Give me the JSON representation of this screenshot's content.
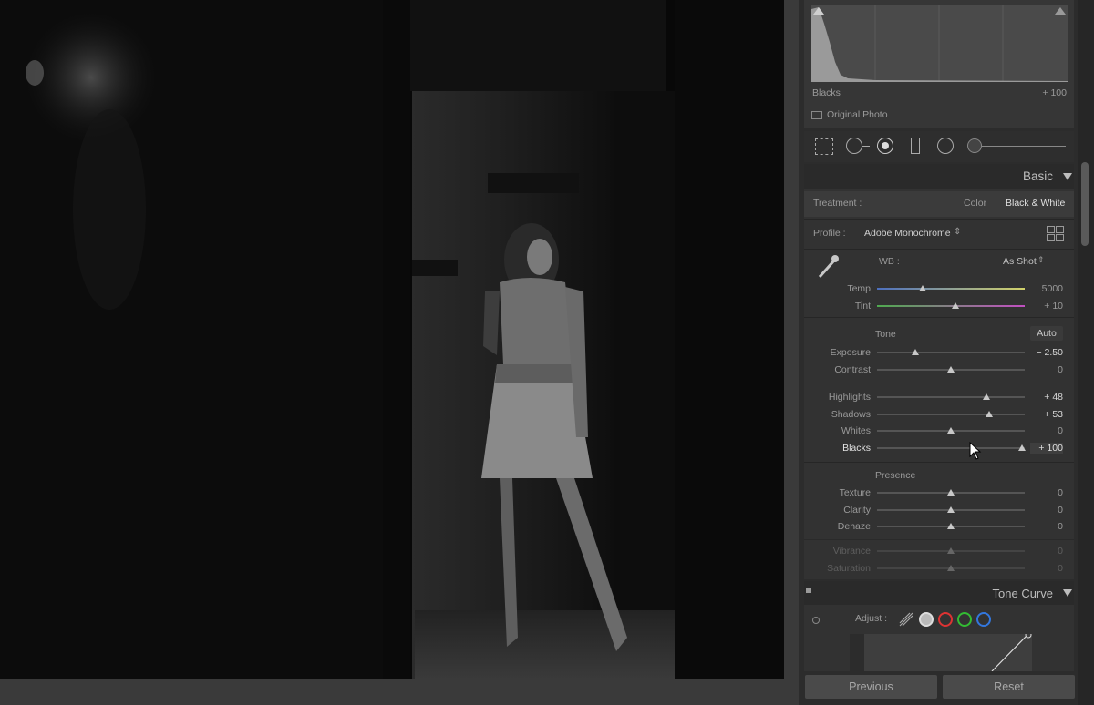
{
  "histogram": {
    "label": "Blacks",
    "value": "+ 100",
    "original_photo": "Original Photo"
  },
  "basic": {
    "title": "Basic",
    "treatment": {
      "label": "Treatment :",
      "color": "Color",
      "bw": "Black & White"
    },
    "profile": {
      "label": "Profile :",
      "value": "Adobe Monochrome"
    },
    "wb": {
      "label": "WB :",
      "value": "As Shot"
    },
    "temp": {
      "label": "Temp",
      "value": "5000",
      "pos": 0.31
    },
    "tint": {
      "label": "Tint",
      "value": "+ 10",
      "pos": 0.53
    },
    "tone_label": "Tone",
    "auto": "Auto",
    "tone": [
      {
        "key": "exposure",
        "label": "Exposure",
        "value": "− 2.50",
        "pos": 0.26
      },
      {
        "key": "contrast",
        "label": "Contrast",
        "value": "0",
        "pos": 0.5
      },
      {
        "key": "highlights",
        "label": "Highlights",
        "value": "+ 48",
        "pos": 0.74
      },
      {
        "key": "shadows",
        "label": "Shadows",
        "value": "+ 53",
        "pos": 0.76
      },
      {
        "key": "whites",
        "label": "Whites",
        "value": "0",
        "pos": 0.5
      },
      {
        "key": "blacks",
        "label": "Blacks",
        "value": "+ 100",
        "pos": 0.98
      }
    ],
    "presence_label": "Presence",
    "presence": [
      {
        "key": "texture",
        "label": "Texture",
        "value": "0",
        "pos": 0.5
      },
      {
        "key": "clarity",
        "label": "Clarity",
        "value": "0",
        "pos": 0.5
      },
      {
        "key": "dehaze",
        "label": "Dehaze",
        "value": "0",
        "pos": 0.5
      }
    ],
    "presence_dim": [
      {
        "key": "vibrance",
        "label": "Vibrance",
        "value": "0",
        "pos": 0.5
      },
      {
        "key": "saturation",
        "label": "Saturation",
        "value": "0",
        "pos": 0.5
      }
    ]
  },
  "tone_curve": {
    "title": "Tone Curve",
    "adjust": "Adjust :"
  },
  "buttons": {
    "previous": "Previous",
    "reset": "Reset"
  }
}
